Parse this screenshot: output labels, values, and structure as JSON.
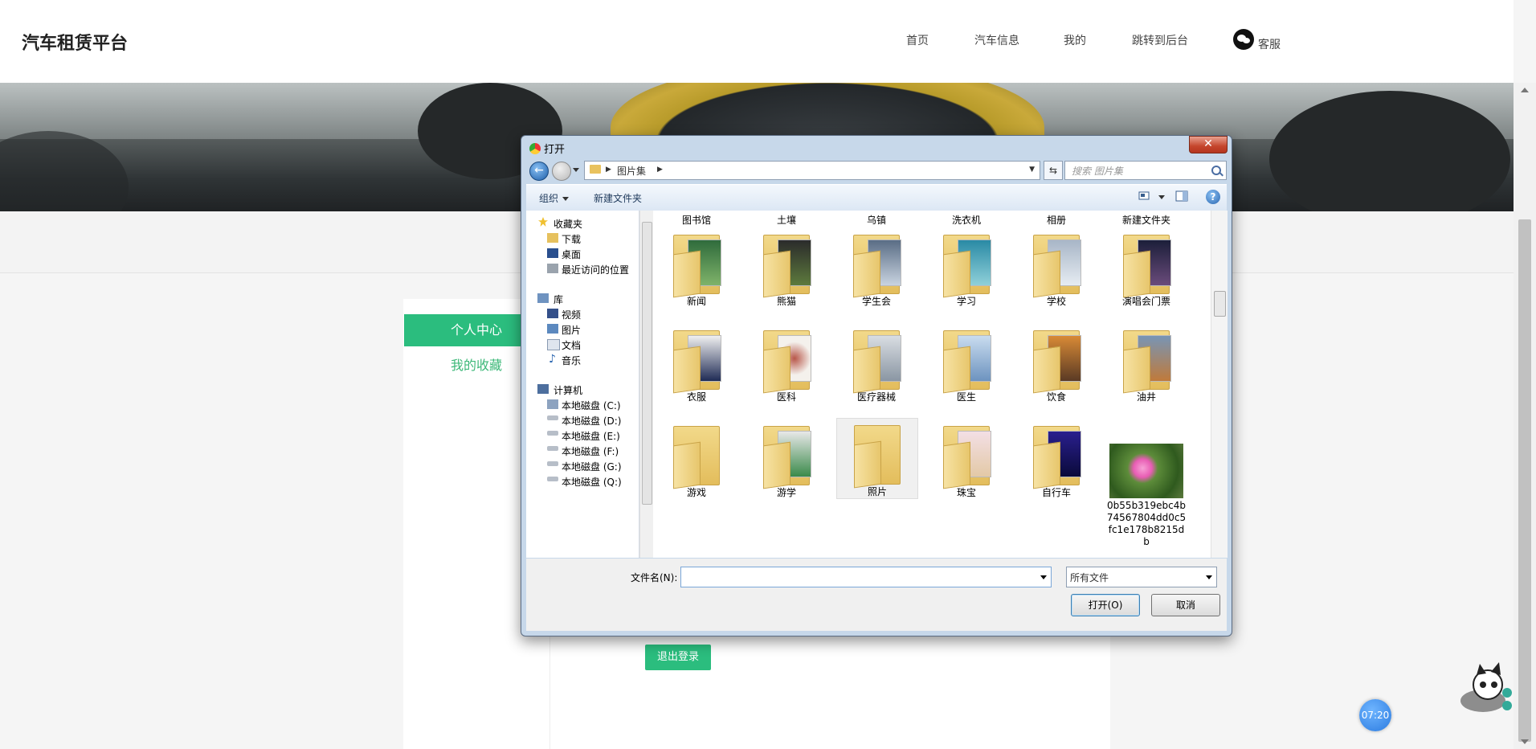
{
  "header": {
    "brand": "汽车租赁平台",
    "nav": [
      "首页",
      "汽车信息",
      "我的",
      "跳转到后台",
      "客服"
    ]
  },
  "sidebar": {
    "active": "个人中心",
    "items": [
      "我的收藏"
    ]
  },
  "main": {
    "logout": "退出登录"
  },
  "clock": "07:20",
  "dialog": {
    "title": "打开",
    "close": "✕",
    "address": {
      "path": [
        "图片集"
      ]
    },
    "search_placeholder": "搜索 图片集",
    "toolbar": {
      "organize": "组织",
      "new_folder": "新建文件夹"
    },
    "nav_pane": {
      "favorites": {
        "label": "收藏夹",
        "items": [
          "下载",
          "桌面",
          "最近访问的位置"
        ]
      },
      "library": {
        "label": "库",
        "items": [
          "视频",
          "图片",
          "文档",
          "音乐"
        ]
      },
      "computer": {
        "label": "计算机",
        "items": [
          "本地磁盘 (C:)",
          "本地磁盘 (D:)",
          "本地磁盘 (E:)",
          "本地磁盘 (F:)",
          "本地磁盘 (G:)",
          "本地磁盘 (Q:)"
        ]
      }
    },
    "files": [
      "图书馆",
      "土壤",
      "乌镇",
      "洗衣机",
      "相册",
      "新建文件夹",
      "新闻",
      "熊猫",
      "学生会",
      "学习",
      "学校",
      "演唱会门票",
      "衣服",
      "医科",
      "医疗器械",
      "医生",
      "饮食",
      "油井",
      "游戏",
      "游学",
      "照片",
      "珠宝",
      "自行车",
      "0b55b319ebc4b74567804dd0c5fc1e178b8215db"
    ],
    "file_name_label": "文件名(N):",
    "file_name_value": "",
    "file_type": "所有文件",
    "open_button": "打开(O)",
    "cancel_button": "取消"
  }
}
